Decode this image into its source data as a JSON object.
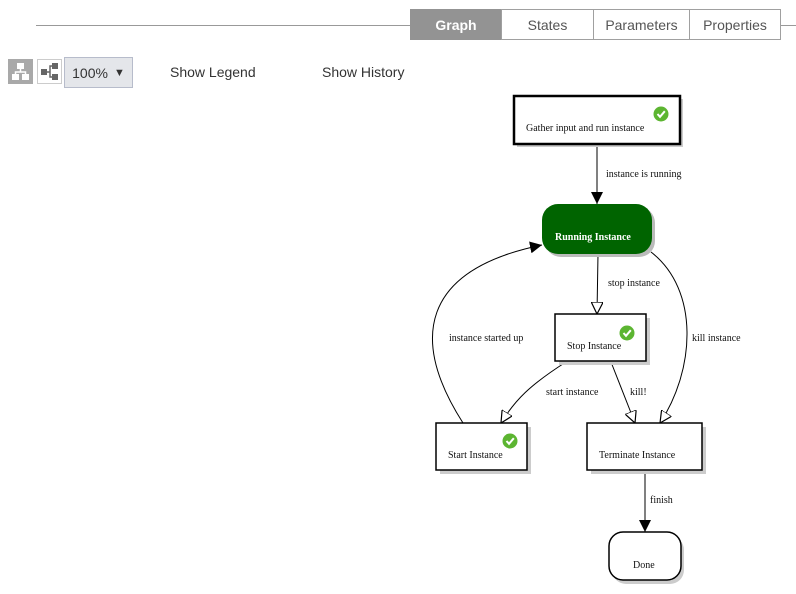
{
  "tabs": [
    {
      "label": "Graph",
      "active": true
    },
    {
      "label": "States",
      "active": false
    },
    {
      "label": "Parameters",
      "active": false
    },
    {
      "label": "Properties",
      "active": false
    }
  ],
  "toolbar": {
    "layout_hierarchical_icon": "hierarchy-icon",
    "layout_horizontal_icon": "horizontal-tree-icon",
    "zoom_value": "100%",
    "zoom_caret": "▼",
    "show_legend": "Show Legend",
    "show_history": "Show History"
  },
  "graph": {
    "nodes": [
      {
        "id": "gather",
        "label": "Gather input and run instance",
        "completed": true,
        "kind": "start"
      },
      {
        "id": "running",
        "label": "Running Instance",
        "completed": false,
        "kind": "current"
      },
      {
        "id": "stop",
        "label": "Stop Instance",
        "completed": true,
        "kind": "state"
      },
      {
        "id": "start",
        "label": "Start Instance",
        "completed": true,
        "kind": "state"
      },
      {
        "id": "terminate",
        "label": "Terminate Instance",
        "completed": false,
        "kind": "state"
      },
      {
        "id": "done",
        "label": "Done",
        "completed": false,
        "kind": "end"
      }
    ],
    "edges": [
      {
        "from": "gather",
        "to": "running",
        "label": "instance is running"
      },
      {
        "from": "running",
        "to": "stop",
        "label": "stop instance"
      },
      {
        "from": "running",
        "to": "terminate",
        "label": "kill instance"
      },
      {
        "from": "start",
        "to": "running",
        "label": "instance started up"
      },
      {
        "from": "stop",
        "to": "start",
        "label": "start instance"
      },
      {
        "from": "stop",
        "to": "terminate",
        "label": "kill!"
      },
      {
        "from": "terminate",
        "to": "done",
        "label": "finish"
      }
    ],
    "colors": {
      "current": "#006400",
      "check": "#5cb531"
    }
  }
}
